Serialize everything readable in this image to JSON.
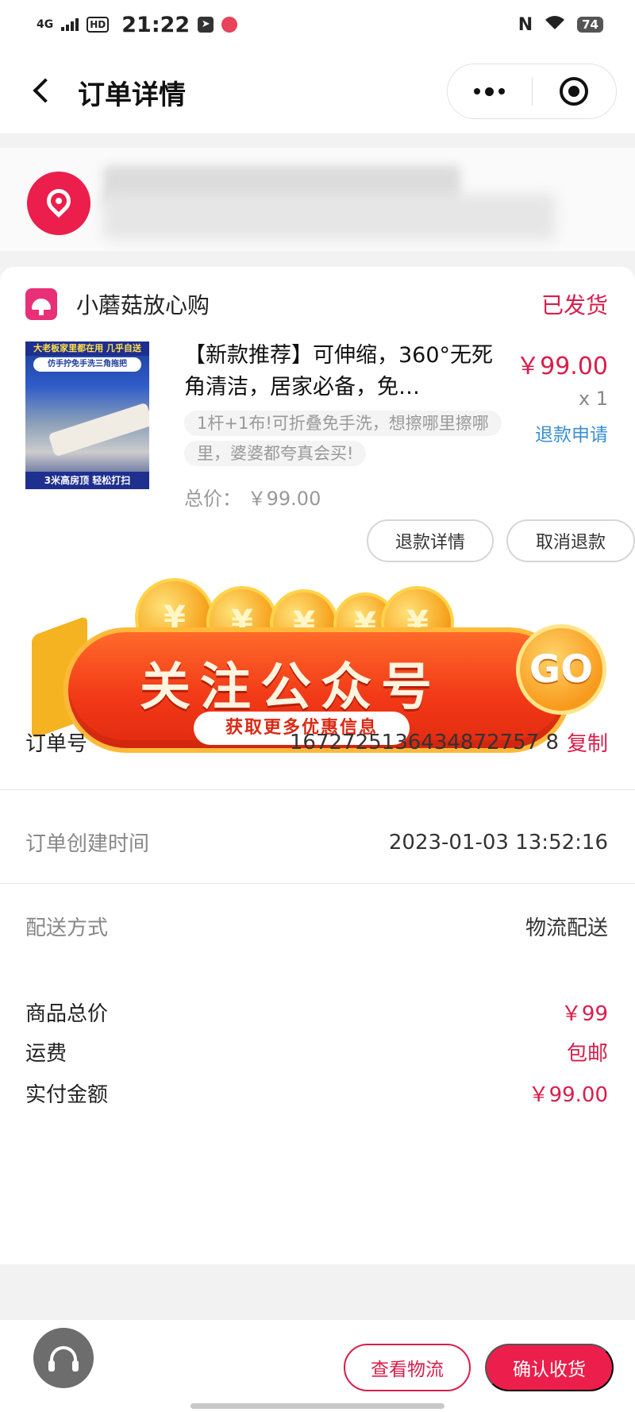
{
  "status_bar": {
    "network": "4G",
    "hd": "HD",
    "time": "21:22",
    "nfc": "N",
    "battery": "74"
  },
  "header": {
    "title": "订单详情"
  },
  "order": {
    "shop_name": "小蘑菇放心购",
    "status": "已发货",
    "goods": {
      "title": "【新款推荐】可伸缩，360°无死角清洁，居家必备，免…",
      "description": "1杆+1布!可折叠免手洗，想擦哪里擦哪里，婆婆都夸真会买!",
      "price": "￥99.00",
      "quantity": "x 1",
      "refund_apply_label": "退款申请",
      "total_label": "总价：",
      "total_value": "￥99.00",
      "image_text": {
        "top": "大老板家里都在用 几乎自送",
        "top2": "仿手拧免手洗三角拖把",
        "bottom": "3米高房顶 轻松打扫"
      }
    },
    "buttons": {
      "refund_detail": "退款详情",
      "cancel_refund": "取消退款"
    }
  },
  "banner": {
    "title": "关注公众号",
    "subtitle": "获取更多优惠信息",
    "go": "GO",
    "coin_glyph": "¥"
  },
  "info": {
    "order_no_label": "订单号",
    "order_no": "1672725136434872757 8",
    "copy_label": "复制",
    "created_label": "订单创建时间",
    "created_value": "2023-01-03 13:52:16",
    "delivery_label": "配送方式",
    "delivery_value": "物流配送",
    "goods_total_label": "商品总价",
    "goods_total_value": "￥99",
    "shipping_label": "运费",
    "shipping_value": "包邮",
    "paid_label": "实付金额",
    "paid_value": "￥99.00"
  },
  "bottom_bar": {
    "view_logistics": "查看物流",
    "confirm_receipt": "确认收货"
  },
  "colors": {
    "accent": "#d81e4c",
    "primary_button": "#ec1e4b",
    "link_blue": "#3a8fd0"
  }
}
